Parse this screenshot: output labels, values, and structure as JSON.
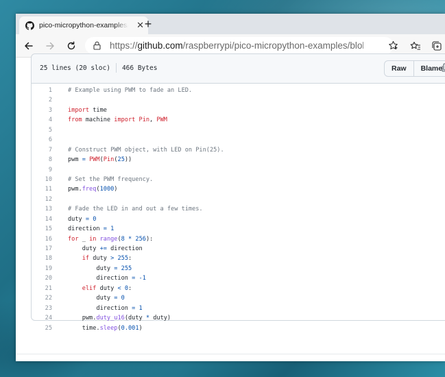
{
  "browser": {
    "tab_title": "pico-micropython-examples/pwm_fade.py",
    "tab_close": "✕",
    "new_tab": "+",
    "url_scheme": "https://",
    "url_host": "github.com",
    "url_rest": "/raspberrypi/pico-micropython-examples/blob/master/p..."
  },
  "file": {
    "lines_info": "25 lines (20 sloc)",
    "size_info": "466 Bytes",
    "raw_label": "Raw",
    "blame_label": "Blame"
  },
  "code_lines": [
    [
      [
        "cm",
        "# Example using PWM to fade an LED."
      ]
    ],
    [],
    [
      [
        "kw",
        "import"
      ],
      [
        "",
        " time"
      ]
    ],
    [
      [
        "kw",
        "from"
      ],
      [
        "",
        " machine "
      ],
      [
        "kw",
        "import"
      ],
      [
        "",
        " "
      ],
      [
        "kw",
        "Pin"
      ],
      [
        "",
        ", "
      ],
      [
        "kw",
        "PWM"
      ]
    ],
    [],
    [],
    [
      [
        "cm",
        "# Construct PWM object, with LED on Pin(25)."
      ]
    ],
    [
      [
        "",
        "pwm "
      ],
      [
        "op",
        "="
      ],
      [
        "",
        " "
      ],
      [
        "kw",
        "PWM"
      ],
      [
        "",
        "("
      ],
      [
        "kw",
        "Pin"
      ],
      [
        "",
        "("
      ],
      [
        "num",
        "25"
      ],
      [
        "",
        "))"
      ]
    ],
    [],
    [
      [
        "cm",
        "# Set the PWM frequency."
      ]
    ],
    [
      [
        "",
        "pwm."
      ],
      [
        "fn",
        "freq"
      ],
      [
        "",
        "("
      ],
      [
        "num",
        "1000"
      ],
      [
        "",
        ")"
      ]
    ],
    [],
    [
      [
        "cm",
        "# Fade the LED in and out a few times."
      ]
    ],
    [
      [
        "",
        "duty "
      ],
      [
        "op",
        "="
      ],
      [
        "",
        " "
      ],
      [
        "num",
        "0"
      ]
    ],
    [
      [
        "",
        "direction "
      ],
      [
        "op",
        "="
      ],
      [
        "",
        " "
      ],
      [
        "num",
        "1"
      ]
    ],
    [
      [
        "kw",
        "for"
      ],
      [
        "",
        " _ "
      ],
      [
        "kw",
        "in"
      ],
      [
        "",
        " "
      ],
      [
        "fn",
        "range"
      ],
      [
        "",
        "("
      ],
      [
        "num",
        "8"
      ],
      [
        "",
        " "
      ],
      [
        "op",
        "*"
      ],
      [
        "",
        " "
      ],
      [
        "num",
        "256"
      ],
      [
        "",
        "):"
      ]
    ],
    [
      [
        "",
        "    duty "
      ],
      [
        "op",
        "+="
      ],
      [
        "",
        " direction"
      ]
    ],
    [
      [
        "",
        "    "
      ],
      [
        "kw",
        "if"
      ],
      [
        "",
        " duty "
      ],
      [
        "op",
        ">"
      ],
      [
        "",
        " "
      ],
      [
        "num",
        "255"
      ],
      [
        "",
        ":"
      ]
    ],
    [
      [
        "",
        "        duty "
      ],
      [
        "op",
        "="
      ],
      [
        "",
        " "
      ],
      [
        "num",
        "255"
      ]
    ],
    [
      [
        "",
        "        direction "
      ],
      [
        "op",
        "="
      ],
      [
        "",
        " "
      ],
      [
        "op",
        "-"
      ],
      [
        "num",
        "1"
      ]
    ],
    [
      [
        "",
        "    "
      ],
      [
        "kw",
        "elif"
      ],
      [
        "",
        " duty "
      ],
      [
        "op",
        "<"
      ],
      [
        "",
        " "
      ],
      [
        "num",
        "0"
      ],
      [
        "",
        ":"
      ]
    ],
    [
      [
        "",
        "        duty "
      ],
      [
        "op",
        "="
      ],
      [
        "",
        " "
      ],
      [
        "num",
        "0"
      ]
    ],
    [
      [
        "",
        "        direction "
      ],
      [
        "op",
        "="
      ],
      [
        "",
        " "
      ],
      [
        "num",
        "1"
      ]
    ],
    [
      [
        "",
        "    pwm."
      ],
      [
        "fn",
        "duty_u16"
      ],
      [
        "",
        "(duty "
      ],
      [
        "op",
        "*"
      ],
      [
        "",
        " duty)"
      ]
    ],
    [
      [
        "",
        "    time."
      ],
      [
        "fn",
        "sleep"
      ],
      [
        "",
        "("
      ],
      [
        "num",
        "0.001"
      ],
      [
        "",
        ")"
      ]
    ]
  ]
}
